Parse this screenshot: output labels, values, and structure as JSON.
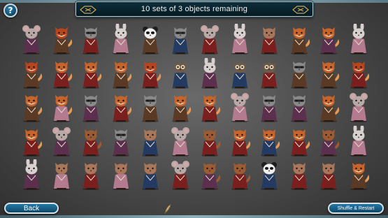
{
  "header": {
    "title": "10 sets of 3 objects remaining"
  },
  "buttons": {
    "help_label": "?",
    "back_label": "Back",
    "shuffle_label": "Shuffle & Restart"
  },
  "icons": {
    "help": "question-mark-icon",
    "cursor": "feather-quill-cursor-icon",
    "ornament": "scroll-ornament-icon"
  },
  "colors": {
    "fox": "#c8632a",
    "fox_light": "#e79a55",
    "cat": "#a9765a",
    "bunny": "#d8cfcf",
    "mouse": "#b9a9a6",
    "panda": "#efefef",
    "panda_dark": "#1d1d1d",
    "raccoon": "#8a8a8a",
    "red_panda": "#b8451d",
    "squirrel": "#9c5b32",
    "owl": "#6d5a48",
    "outfit_red": "#7a1e1e",
    "outfit_pink": "#b37a90",
    "outfit_navy": "#233a63",
    "outfit_plum": "#5b2f4d",
    "outfit_brown": "#5a3a24",
    "button_blue": "#1a628a",
    "title_bar": "#0a2630"
  },
  "board": {
    "rows": [
      [
        "mouse",
        "red_panda",
        "raccoon",
        "bunny",
        "panda",
        "raccoon",
        "mouse",
        "bunny",
        "cat",
        "fox",
        "fox",
        "bunny"
      ],
      [
        "red_panda",
        "fox",
        "fox",
        "fox",
        "red_panda",
        "owl",
        "bunny",
        "owl",
        "owl",
        "raccoon",
        "fox",
        "red_panda"
      ],
      [
        "fox",
        "fox",
        "raccoon",
        "fox",
        "raccoon",
        "fox",
        "fox",
        "mouse",
        "raccoon",
        "raccoon",
        "fox",
        "mouse"
      ],
      [
        "fox",
        "mouse",
        "squirrel",
        "raccoon",
        "cat",
        "mouse",
        "squirrel",
        "fox",
        "fox",
        "fox",
        "squirrel",
        "bunny"
      ],
      [
        "bunny",
        "cat",
        "cat",
        "cat",
        "cat",
        "mouse",
        "squirrel",
        "squirrel",
        "panda",
        "cat",
        "cat",
        "fox"
      ]
    ],
    "outfits": [
      [
        "outfit_plum",
        "outfit_brown",
        "outfit_red",
        "outfit_pink",
        "outfit_brown",
        "outfit_navy",
        "outfit_red",
        "outfit_pink",
        "outfit_red",
        "outfit_brown",
        "outfit_plum",
        "outfit_pink"
      ],
      [
        "outfit_brown",
        "outfit_red",
        "outfit_red",
        "outfit_brown",
        "outfit_red",
        "outfit_navy",
        "outfit_plum",
        "outfit_navy",
        "outfit_red",
        "outfit_brown",
        "outfit_brown",
        "outfit_red"
      ],
      [
        "outfit_brown",
        "outfit_pink",
        "outfit_plum",
        "outfit_red",
        "outfit_brown",
        "outfit_brown",
        "outfit_red",
        "outfit_pink",
        "outfit_plum",
        "outfit_plum",
        "outfit_brown",
        "outfit_pink"
      ],
      [
        "outfit_red",
        "outfit_plum",
        "outfit_red",
        "outfit_plum",
        "outfit_navy",
        "outfit_pink",
        "outfit_red",
        "outfit_red",
        "outfit_navy",
        "outfit_red",
        "outfit_plum",
        "outfit_pink"
      ],
      [
        "outfit_plum",
        "outfit_pink",
        "outfit_red",
        "outfit_pink",
        "outfit_navy",
        "outfit_red",
        "outfit_plum",
        "outfit_red",
        "outfit_navy",
        "outfit_red",
        "outfit_red",
        "outfit_brown"
      ]
    ]
  }
}
